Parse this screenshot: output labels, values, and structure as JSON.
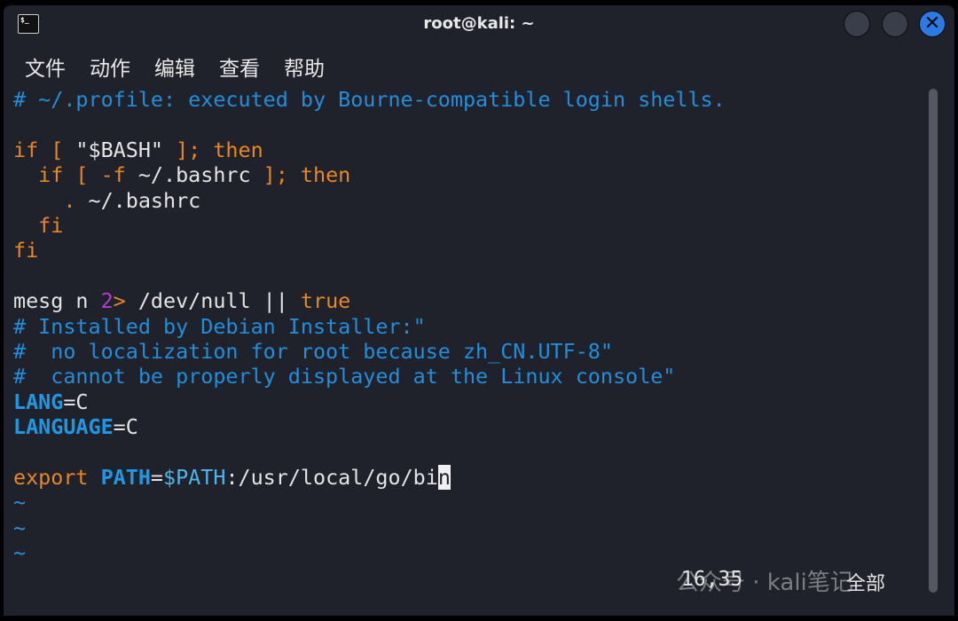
{
  "window": {
    "title": "root@kali: ~",
    "close_glyph": "✕"
  },
  "menu": [
    "文件",
    "动作",
    "编辑",
    "查看",
    "帮助"
  ],
  "editor": {
    "lines": [
      [
        [
          "c-comment",
          "# ~/.profile: executed by Bourne-compatible login shells."
        ]
      ],
      [],
      [
        [
          "c-kw",
          "if [ "
        ],
        [
          "c-plain",
          "\"$BASH\""
        ],
        [
          "c-kw",
          " ]; then"
        ]
      ],
      [
        [
          "c-kw",
          "  if [ -f "
        ],
        [
          "c-plain",
          "~/.bashrc"
        ],
        [
          "c-kw",
          " ]; then"
        ]
      ],
      [
        [
          "c-kw",
          "    . "
        ],
        [
          "c-plain",
          "~/.bashrc"
        ]
      ],
      [
        [
          "c-kw",
          "  fi"
        ]
      ],
      [
        [
          "c-kw",
          "fi"
        ]
      ],
      [],
      [
        [
          "c-plain",
          "mesg n "
        ],
        [
          "c-num",
          "2"
        ],
        [
          "c-kw",
          ">"
        ],
        [
          "c-plain",
          " /dev/null || "
        ],
        [
          "c-kw",
          "true"
        ]
      ],
      [
        [
          "c-comment",
          "# Installed by Debian Installer:\""
        ]
      ],
      [
        [
          "c-comment",
          "#  no localization for root because zh_CN.UTF-8\""
        ]
      ],
      [
        [
          "c-comment",
          "#  cannot be properly displayed at the Linux console\""
        ]
      ],
      [
        [
          "c-var",
          "LANG"
        ],
        [
          "c-plain",
          "=C"
        ]
      ],
      [
        [
          "c-var",
          "LANGUAGE"
        ],
        [
          "c-plain",
          "=C"
        ]
      ],
      [],
      [
        [
          "c-kw",
          "export "
        ],
        [
          "c-var",
          "PATH"
        ],
        [
          "c-plain",
          "="
        ],
        [
          "c-ref",
          "$PATH"
        ],
        [
          "c-plain",
          ":/usr/local/go/bi"
        ],
        [
          "cursor",
          "n"
        ]
      ],
      [
        [
          "c-tilde",
          "~"
        ]
      ],
      [
        [
          "c-tilde",
          "~"
        ]
      ],
      [
        [
          "c-tilde",
          "~"
        ]
      ]
    ],
    "cursor_position": "16,35",
    "scroll_position": "全部"
  },
  "watermark": "公众号 · kali笔记",
  "colors": {
    "background": "#20222b",
    "comment": "#1f8fdc",
    "keyword": "#e8861f",
    "close_button": "#2a7ae8"
  }
}
